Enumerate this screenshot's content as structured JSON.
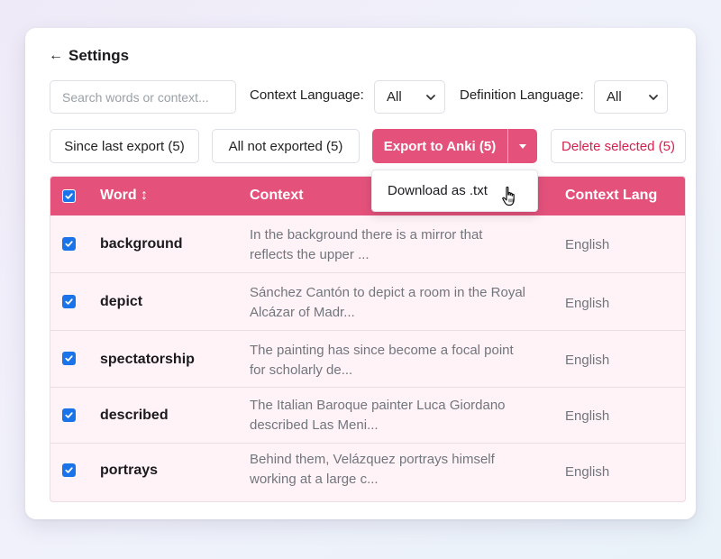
{
  "header": {
    "back_icon": "←",
    "title": "Settings"
  },
  "filters": {
    "search_placeholder": "Search words or context...",
    "context_language_label": "Context Language:",
    "context_language_value": "All",
    "definition_language_label": "Definition Language:",
    "definition_language_value": "All"
  },
  "actions": {
    "since_last_export": "Since last export (5)",
    "all_not_exported": "All not exported (5)",
    "export_to_anki": "Export to Anki (5)",
    "delete_selected": "Delete selected (5)"
  },
  "dropdown": {
    "download_txt": "Download as .txt"
  },
  "table": {
    "columns": {
      "word": "Word ↕",
      "context": "Context",
      "context_lang": "Context Lang"
    },
    "rows": [
      {
        "word": "background",
        "context_line1": "In the background there is a mirror that",
        "context_line2": "reflects the upper ...",
        "lang": "English",
        "checked": true
      },
      {
        "word": "depict",
        "context_line1": "Sánchez Cantón to depict a room in the Royal",
        "context_line2": "Alcázar of Madr...",
        "lang": "English",
        "checked": true
      },
      {
        "word": "spectatorship",
        "context_line1": "The painting has since become a focal point",
        "context_line2": "for scholarly de...",
        "lang": "English",
        "checked": true
      },
      {
        "word": "described",
        "context_line1": "The Italian Baroque painter Luca Giordano",
        "context_line2": "described Las Meni...",
        "lang": "English",
        "checked": true
      },
      {
        "word": "portrays",
        "context_line1": "Behind them, Velázquez portrays himself",
        "context_line2": "working at a large c...",
        "lang": "English",
        "checked": true
      }
    ]
  },
  "colors": {
    "accent": "#e4527c",
    "checkbox": "#1a73e8",
    "danger": "#d6214e",
    "row_bg": "#fff3f7"
  },
  "icons": [
    "arrow-left-icon",
    "chevron-down-icon",
    "caret-down-icon",
    "check-icon",
    "hand-pointer-icon"
  ]
}
